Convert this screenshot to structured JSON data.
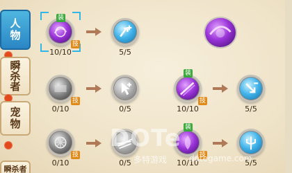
{
  "tabs": [
    {
      "label": "人\n物",
      "active": true
    },
    {
      "label": "瞬\n杀\n者",
      "active": false
    },
    {
      "label": "宠\n物",
      "active": false
    },
    {
      "label": "瞬杀者",
      "active": false
    }
  ],
  "rows": [
    {
      "nodes": [
        {
          "name": "skill-purple-orb",
          "style": "purple",
          "count": "10/10",
          "badge_top": "装",
          "badge_side": "技"
        },
        {
          "name": "stat-blue-plus",
          "style": "blue",
          "count": "5/5"
        },
        {
          "name": "skill-purple-orb-large",
          "style": "purple",
          "count": ""
        }
      ]
    },
    {
      "nodes": [
        {
          "name": "skill-steel-orb",
          "style": "steel",
          "count": "0/10",
          "badge_top": "",
          "badge_side": "技"
        },
        {
          "name": "stat-grey-arrow",
          "style": "grey",
          "count": "0/5"
        },
        {
          "name": "skill-purple-slash",
          "style": "purple",
          "count": "10/10",
          "badge_top": "装",
          "badge_side": "技"
        },
        {
          "name": "stat-blue-minus",
          "style": "blue",
          "count": "5/5"
        }
      ]
    },
    {
      "nodes": [
        {
          "name": "skill-steel-wheel",
          "style": "steel",
          "count": "0/10",
          "badge_top": "",
          "badge_side": "技"
        },
        {
          "name": "stat-grey-blades",
          "style": "grey",
          "count": "0/5"
        },
        {
          "name": "skill-purple-flame",
          "style": "purple",
          "count": "10/10",
          "badge_top": "装",
          "badge_side": "技"
        },
        {
          "name": "stat-blue-trident",
          "style": "blue",
          "count": "5/5"
        }
      ]
    }
  ],
  "watermark": {
    "logo": "DOTe",
    "text": "多特游戏",
    "url": "dotegame.com"
  },
  "colors": {
    "accent": "#2a86c4",
    "badge_green": "#3aa83a",
    "badge_orange": "#e08a1a",
    "alert_dot": "#e24a1c"
  }
}
